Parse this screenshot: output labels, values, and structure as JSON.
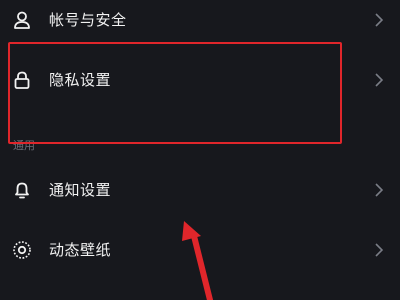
{
  "settings": {
    "items": [
      {
        "label": "帐号与安全",
        "icon": "person-icon"
      },
      {
        "label": "隐私设置",
        "icon": "lock-icon"
      },
      {
        "label": "通知设置",
        "icon": "bell-icon"
      },
      {
        "label": "动态壁纸",
        "icon": "wallpaper-icon"
      }
    ],
    "section_general": "通用"
  },
  "colors": {
    "background": "#17181d",
    "text": "#f2f2f2",
    "muted": "#6b6e78",
    "chevron": "#7a7d86",
    "annotation": "#e0262b"
  }
}
